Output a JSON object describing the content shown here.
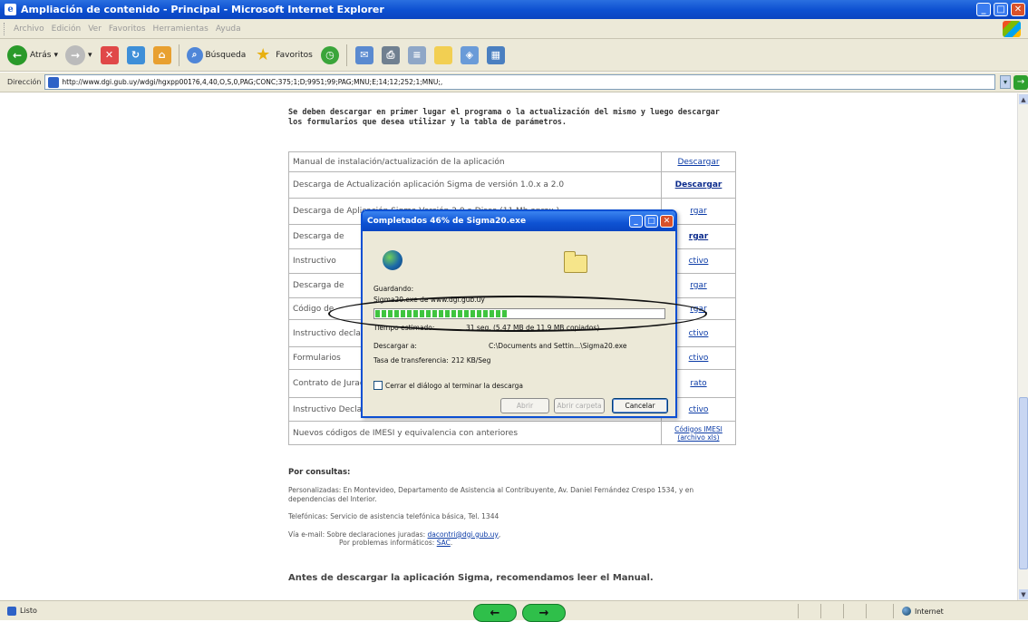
{
  "window": {
    "title": "Ampliación de contenido - Principal - Microsoft Internet Explorer",
    "menu": [
      "Archivo",
      "Edición",
      "Ver",
      "Favoritos",
      "Herramientas",
      "Ayuda"
    ],
    "toolbar": {
      "back": "Atrás",
      "search": "Búsqueda",
      "favorites": "Favoritos"
    },
    "address_label": "Dirección",
    "address_url": "http://www.dgi.gub.uy/wdgi/hgxpp001?6,4,40,O,S,0,PAG;CONC;375;1;D;9951;99;PAG;MNU;E;14;12;252;1;MNU;,",
    "status": "Listo",
    "zone": "Internet"
  },
  "page": {
    "intro": "Se deben descargar en primer lugar el programa o la actualización del mismo y luego descargar los formularios que desea utilizar y la tabla de parámetros.",
    "rows": [
      {
        "desc": "Manual de instalación/actualización de la aplicación",
        "link": "Descargar"
      },
      {
        "desc": "Descarga de Actualización aplicación Sigma de versión 1.0.x a 2.0",
        "link": "Descargar"
      },
      {
        "desc": "Descarga de Aplicación Sigma Versión 2.0 a Disco (11 Mb aprox.)",
        "link": "rgar"
      },
      {
        "desc": "Descarga de",
        "link": "rgar"
      },
      {
        "desc": "Instructivo",
        "link": "ctivo"
      },
      {
        "desc": "Descarga de",
        "link": "rgar"
      },
      {
        "desc": "Código de",
        "link": "rgar"
      },
      {
        "desc": "Instructivo declaracione",
        "link": "ctivo"
      },
      {
        "desc": "Formularios",
        "link": "ctivo"
      },
      {
        "desc": "Contrato de Juradas por",
        "link": "rato"
      },
      {
        "desc": "Instructivo Declaraciones Juradas por Internet",
        "link": "ctivo"
      },
      {
        "desc": "Nuevos códigos de IMESI y equivalencia con anteriores",
        "link": "Códigos IMESI (archivo xls)"
      }
    ],
    "consult": {
      "heading": "Por consultas:",
      "p1": "Personalizadas: En Montevideo, Departamento de Asistencia al Contribuyente, Av. Daniel Fernández Crespo 1534, y en dependencias del Interior.",
      "p2": "Telefónicas: Servicio de asistencia telefónica básica, Tel. 1344",
      "p3_prefix": "Vía e-mail: Sobre declaraciones juradas: ",
      "p3_link": "dacontri@dgi.gub.uy",
      "p4_prefix": "Por problemas informáticos: ",
      "p4_link": "SAC"
    },
    "bottom": "Antes de descargar la aplicación Sigma, recomendamos leer el Manual."
  },
  "dialog": {
    "title": "Completados 46% de Sigma20.exe",
    "saving_label": "Guardando:",
    "saving_value": "Sigma20.exe de www.dgi.gub.uy",
    "progress": 0.46,
    "time_label": "Tiempo estimado:",
    "time_value": "31 seg. (5,47 MB de 11,9 MB copiados)",
    "dest_label": "Descargar a:",
    "dest_value": "C:\\Documents and Settin...\\Sigma20.exe",
    "rate_label": "Tasa de transferencia:",
    "rate_value": "212 KB/Seg",
    "checkbox_label": "Cerrar el diálogo al terminar la descarga",
    "btn_open": "Abrir",
    "btn_open_folder": "Abrir carpeta",
    "btn_cancel": "Cancelar"
  }
}
